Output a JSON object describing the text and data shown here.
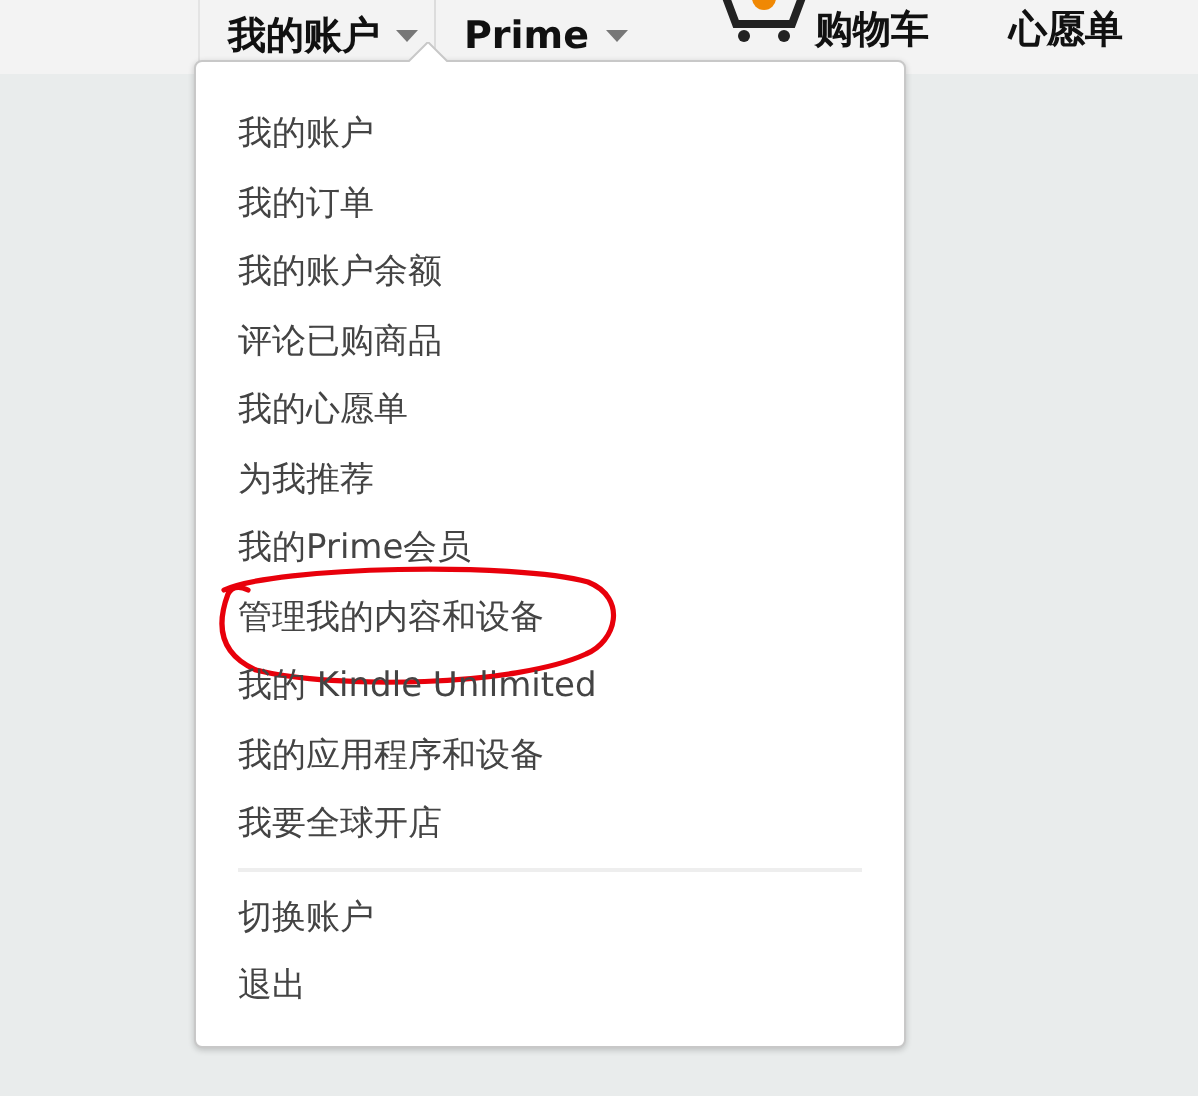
{
  "nav": [
    {
      "label": "我的账户",
      "kind": "dropdown",
      "expanded": true
    },
    {
      "label": "Prime",
      "kind": "dropdown",
      "expanded": false
    },
    {
      "label": "购物车",
      "kind": "cart"
    },
    {
      "label": "心愿单",
      "kind": "plain"
    }
  ],
  "menu": {
    "sections": [
      [
        {
          "label": "我的账户",
          "circled": false
        },
        {
          "label": "我的订单",
          "circled": false
        },
        {
          "label": "我的账户余额",
          "circled": false
        },
        {
          "label": "评论已购商品",
          "circled": false
        },
        {
          "label": "我的心愿单",
          "circled": false
        },
        {
          "label": "为我推荐",
          "circled": false
        },
        {
          "label": "我的Prime会员",
          "circled": false
        },
        {
          "label": "管理我的内容和设备",
          "circled": true
        },
        {
          "label": "我的 Kindle Unlimited",
          "circled": false
        },
        {
          "label": "我的应用程序和设备",
          "circled": false
        },
        {
          "label": "我要全球开店",
          "circled": false
        }
      ],
      [
        {
          "label": "切换账户",
          "circled": false
        },
        {
          "label": "退出",
          "circled": false
        }
      ]
    ]
  }
}
